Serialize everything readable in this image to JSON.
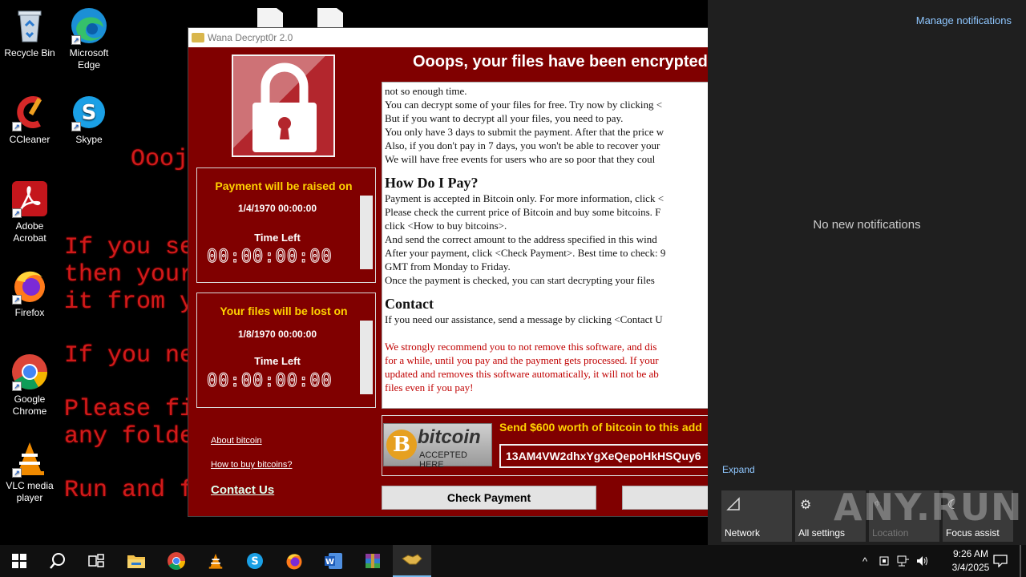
{
  "desktop": {
    "icons": [
      {
        "label": "Recycle Bin",
        "icon": "recycle-bin-icon"
      },
      {
        "label": "Microsoft Edge",
        "icon": "edge-icon"
      },
      {
        "label": "CCleaner",
        "icon": "ccleaner-icon"
      },
      {
        "label": "Skype",
        "icon": "skype-icon"
      },
      {
        "label": "Adobe Acrobat",
        "icon": "acrobat-icon"
      },
      {
        "label": "Firefox",
        "icon": "firefox-icon"
      },
      {
        "label": "Google Chrome",
        "icon": "chrome-icon"
      },
      {
        "label": "VLC media player",
        "icon": "vlc-icon"
      }
    ],
    "wallpaper_lines": [
      "Oooj",
      "If you se",
      "then your",
      "it from y",
      "If you ne",
      "Please fi",
      "any folde",
      "Run and f"
    ]
  },
  "wana": {
    "title": "Wana Decrypt0r 2.0",
    "headline": "Ooops, your files have been encrypted!",
    "raise": {
      "heading": "Payment will be raised on",
      "date": "1/4/1970 00:00:00",
      "time_left_label": "Time Left",
      "countdown": "00:00:00:00"
    },
    "lost": {
      "heading": "Your files will be lost on",
      "date": "1/8/1970 00:00:00",
      "time_left_label": "Time Left",
      "countdown": "00:00:00:00"
    },
    "links": {
      "about": "About bitcoin",
      "how": "How to buy bitcoins?",
      "contact": "Contact Us"
    },
    "text": {
      "p1": [
        "not so enough time.",
        "You can decrypt some of your files for free. Try now by clicking <",
        "But if you want to decrypt all your files, you need to pay.",
        "You only have 3 days to submit the payment. After that the price w",
        "Also, if you don't pay in 7 days, you won't be able to recover your",
        "We will have free events for users who are so poor that they coul"
      ],
      "h_pay": "How Do I Pay?",
      "p2": [
        "Payment is accepted in Bitcoin only. For more information, click <",
        "Please check the current price of Bitcoin and buy some bitcoins. F",
        "click <How to buy bitcoins>.",
        "And send the correct amount to the address specified in this wind",
        "After your payment, click <Check Payment>. Best time to check: 9",
        "GMT from Monday to Friday.",
        "Once the payment is checked, you can start decrypting your files"
      ],
      "h_contact": "Contact",
      "p3": "If you need our assistance, send a message by clicking <Contact U",
      "warning": [
        "We strongly recommend you to not remove this software, and dis",
        "for a while, until you pay and the payment gets processed. If your",
        "updated and removes this software automatically, it will not be ab",
        "files even if you pay!"
      ]
    },
    "bitcoin": {
      "logo_word": "bitcoin",
      "logo_sub": "ACCEPTED HERE",
      "send_label": "Send $600 worth of bitcoin to this add",
      "address": "13AM4VW2dhxYgXeQepoHkHSQuy6"
    },
    "buttons": {
      "check_payment": "Check Payment",
      "decrypt": ""
    }
  },
  "notifications": {
    "manage": "Manage notifications",
    "empty": "No new notifications",
    "expand": "Expand",
    "quick_actions": [
      {
        "label": "Network",
        "icon": "network-icon"
      },
      {
        "label": "All settings",
        "icon": "gear-icon"
      },
      {
        "label": "Location",
        "icon": "location-icon"
      },
      {
        "label": "Focus assist",
        "icon": "moon-icon"
      }
    ],
    "watermark": "ANY.RUN"
  },
  "taskbar": {
    "clock_time": "9:26 AM",
    "clock_date": "3/4/2025"
  },
  "colors": {
    "window_bg": "#800000",
    "accent_yellow": "#ffd200",
    "warning_red": "#c00000",
    "notif_bg": "#1f1f1f",
    "link_blue": "#8fc7ff"
  }
}
